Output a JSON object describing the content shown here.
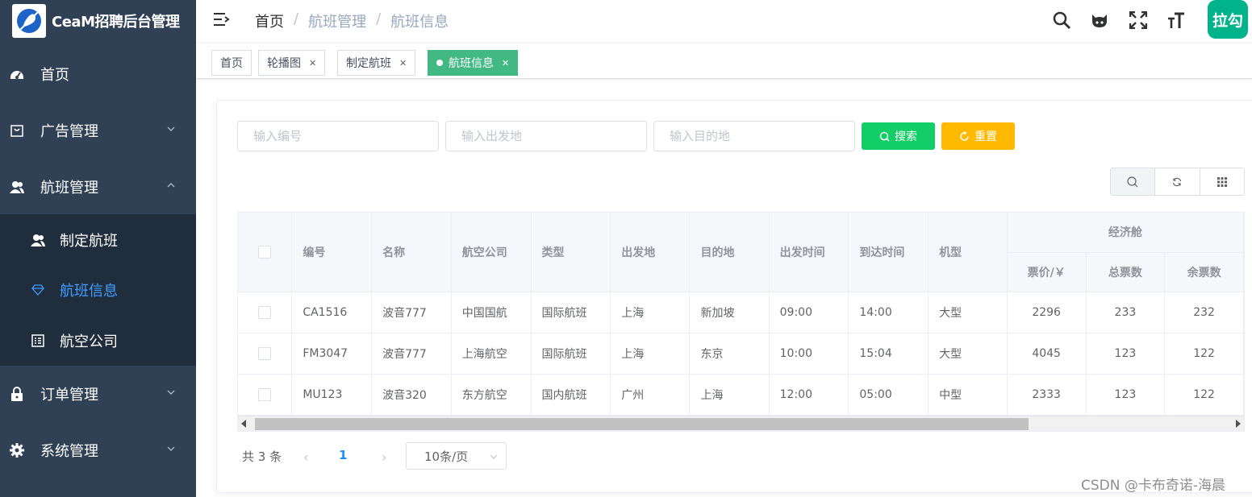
{
  "app": {
    "title": "CeaM招聘后台管理"
  },
  "sidebar": {
    "items": [
      {
        "label": "首页",
        "icon": "dashboard-icon"
      },
      {
        "label": "广告管理",
        "icon": "shopping-bag-icon"
      },
      {
        "label": "航班管理",
        "icon": "user-group-icon"
      },
      {
        "label": "订单管理",
        "icon": "lock-icon"
      },
      {
        "label": "系统管理",
        "icon": "gear-icon"
      }
    ],
    "subitems": [
      {
        "label": "制定航班",
        "icon": "users-icon"
      },
      {
        "label": "航班信息",
        "icon": "diamond-icon"
      },
      {
        "label": "航空公司",
        "icon": "list-icon"
      }
    ]
  },
  "header": {
    "breadcrumb": [
      "首页",
      "航班管理",
      "航班信息"
    ],
    "lagou_label": "拉勾"
  },
  "tags": [
    {
      "label": "首页"
    },
    {
      "label": "轮播图"
    },
    {
      "label": "制定航班"
    },
    {
      "label": "航班信息"
    }
  ],
  "search": {
    "code_placeholder": "输入编号",
    "from_placeholder": "输入出发地",
    "to_placeholder": "输入目的地",
    "search_label": "搜索",
    "reset_label": "重置"
  },
  "table": {
    "headers": {
      "code": "编号",
      "name": "名称",
      "airline": "航空公司",
      "type": "类型",
      "from": "出发地",
      "to": "目的地",
      "depart": "出发时间",
      "arrive": "到达时间",
      "model": "机型",
      "economy": "经济舱",
      "price": "票价/￥",
      "total": "总票数",
      "remain": "余票数"
    },
    "rows": [
      {
        "code": "CA1516",
        "name": "波音777",
        "airline": "中国国航",
        "type": "国际航班",
        "from": "上海",
        "to": "新加坡",
        "depart": "09:00",
        "arrive": "14:00",
        "model": "大型",
        "price": "2296",
        "total": "233",
        "remain": "232"
      },
      {
        "code": "FM3047",
        "name": "波音777",
        "airline": "上海航空",
        "type": "国际航班",
        "from": "上海",
        "to": "东京",
        "depart": "10:00",
        "arrive": "15:04",
        "model": "大型",
        "price": "4045",
        "total": "123",
        "remain": "122"
      },
      {
        "code": "MU123",
        "name": "波音320",
        "airline": "东方航空",
        "type": "国内航班",
        "from": "广州",
        "to": "上海",
        "depart": "12:00",
        "arrive": "05:00",
        "model": "中型",
        "price": "2333",
        "total": "123",
        "remain": "122"
      }
    ]
  },
  "pagination": {
    "total_text": "共 3 条",
    "current_page": "1",
    "page_size": "10条/页"
  },
  "watermark": "CSDN @卡布奇诺-海晨",
  "colors": {
    "sidebar": "#304156",
    "submenu": "#1f2d3d",
    "active": "#409eff",
    "tag_active": "#42b983",
    "search": "#13ce66",
    "reset": "#ffba00",
    "lagou": "#00b38a"
  }
}
